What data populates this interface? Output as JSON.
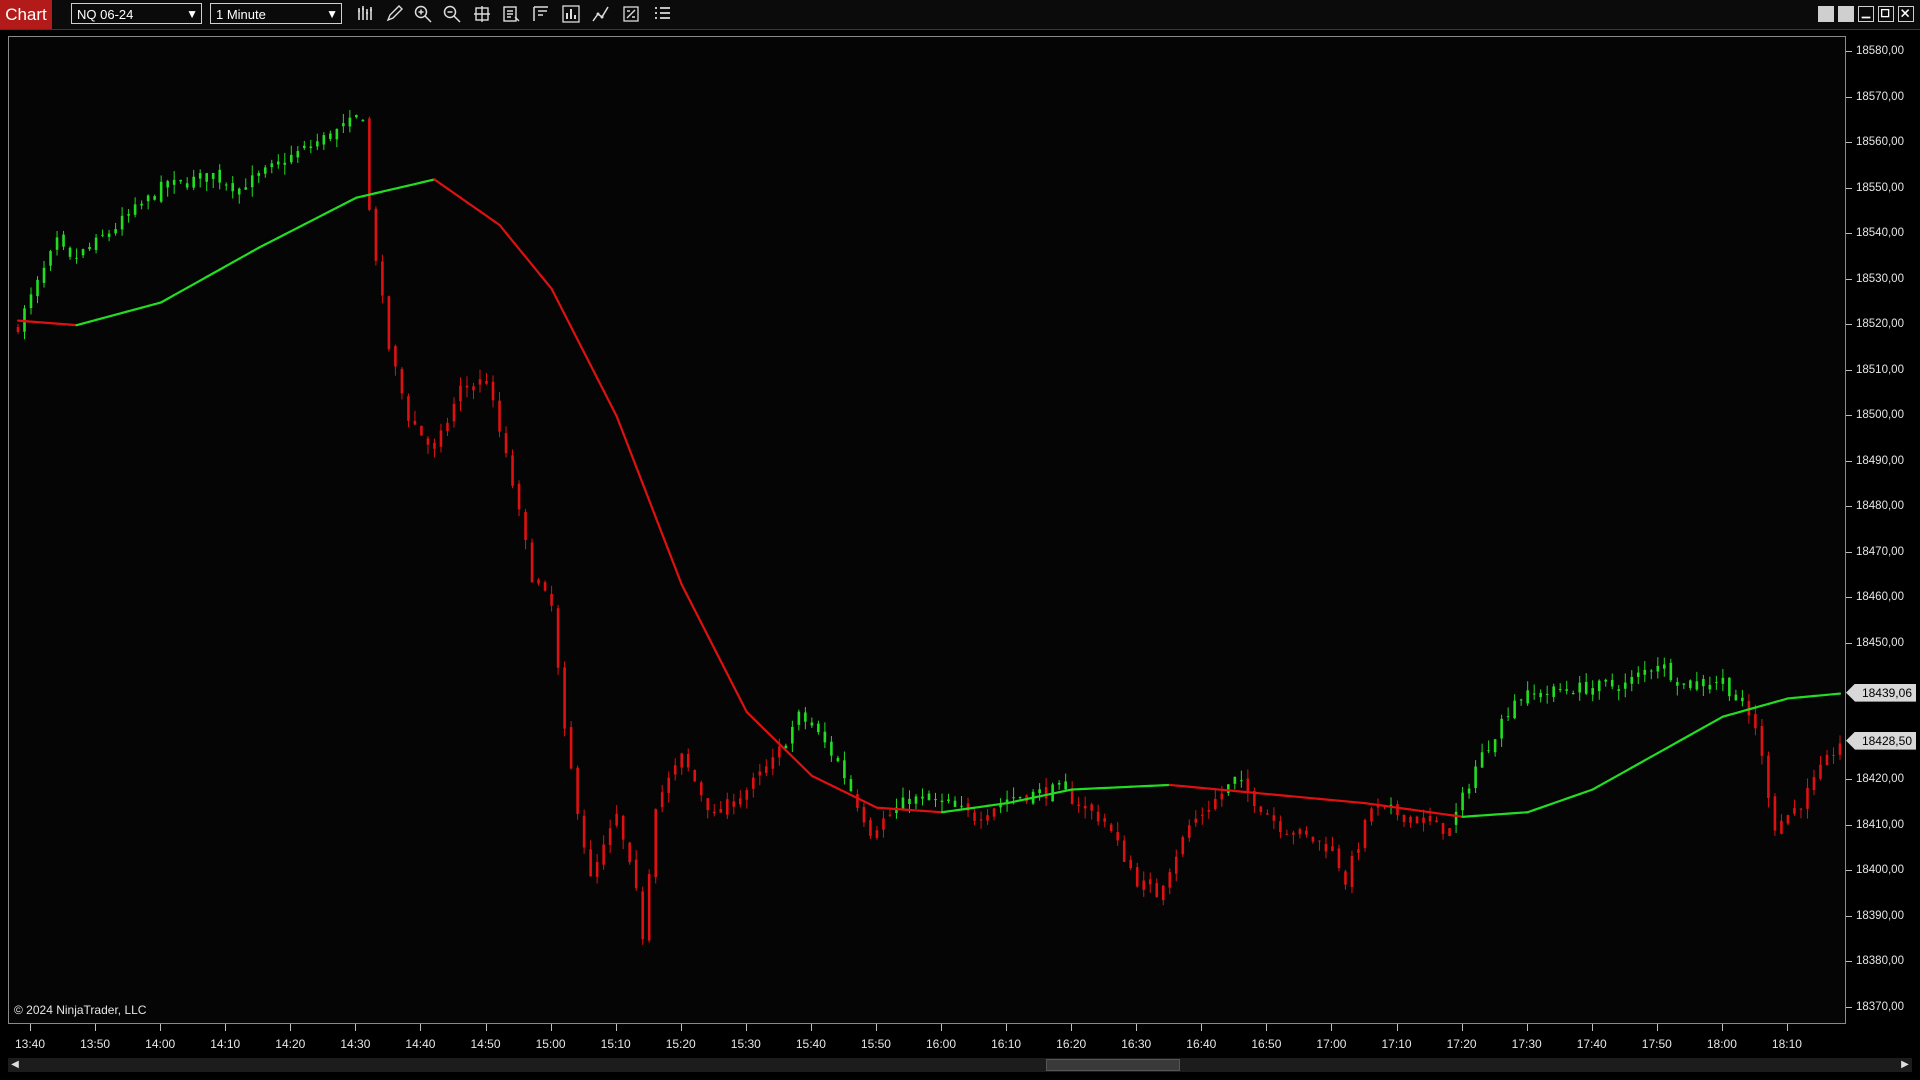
{
  "toolbar": {
    "tab_label": "Chart",
    "instrument": "NQ 06-24",
    "interval": "1 Minute",
    "icons": [
      "bars-type-icon",
      "draw-pencil-icon",
      "zoom-in-icon",
      "zoom-out-icon",
      "crosshair-icon",
      "data-box-icon",
      "range-icon",
      "bar-chart-icon",
      "strategy-icon",
      "properties-icon",
      "indicators-list-icon"
    ],
    "window_icons": [
      "tile-icon",
      "tile-icon",
      "minimize-icon",
      "maximize-icon",
      "close-icon"
    ]
  },
  "colors": {
    "up": "#22dd22",
    "down": "#dd1111",
    "background": "#050505",
    "axis_text": "#e6e6e6"
  },
  "copyright": "© 2024 NinjaTrader, LLC",
  "price_axis": {
    "labels": [
      "18580,00",
      "18570,00",
      "18560,00",
      "18550,00",
      "18540,00",
      "18530,00",
      "18520,00",
      "18510,00",
      "18500,00",
      "18490,00",
      "18480,00",
      "18470,00",
      "18460,00",
      "18450,00",
      "18420,00",
      "18410,00",
      "18400,00",
      "18390,00",
      "18380,00",
      "18370,00"
    ],
    "values": [
      18580,
      18570,
      18560,
      18550,
      18540,
      18530,
      18520,
      18510,
      18500,
      18490,
      18480,
      18470,
      18460,
      18450,
      18420,
      18410,
      18400,
      18390,
      18380,
      18370
    ],
    "ma_value_label": "18439,06",
    "last_price_label": "18428,50"
  },
  "time_axis": {
    "labels": [
      "13:40",
      "13:50",
      "14:00",
      "14:10",
      "14:20",
      "14:30",
      "14:40",
      "14:50",
      "15:00",
      "15:10",
      "15:20",
      "15:30",
      "15:40",
      "15:50",
      "16:00",
      "16:10",
      "16:20",
      "16:30",
      "16:40",
      "16:50",
      "17:00",
      "17:10",
      "17:20",
      "17:30",
      "17:40",
      "17:50",
      "18:00",
      "18:10"
    ]
  },
  "chart_data": {
    "type": "candlestick",
    "instrument": "NQ 06-24",
    "interval": "1 Minute",
    "ylim": [
      18367,
      18582
    ],
    "close_anchors": [
      {
        "t": "13:38",
        "p": 18520
      },
      {
        "t": "13:44",
        "p": 18538
      },
      {
        "t": "13:46",
        "p": 18534
      },
      {
        "t": "13:50",
        "p": 18538
      },
      {
        "t": "14:00",
        "p": 18550
      },
      {
        "t": "14:08",
        "p": 18553
      },
      {
        "t": "14:12",
        "p": 18550
      },
      {
        "t": "14:20",
        "p": 18557
      },
      {
        "t": "14:30",
        "p": 18565
      },
      {
        "t": "14:31",
        "p": 18566
      },
      {
        "t": "14:32",
        "p": 18545
      },
      {
        "t": "14:35",
        "p": 18515
      },
      {
        "t": "14:38",
        "p": 18500
      },
      {
        "t": "14:42",
        "p": 18492
      },
      {
        "t": "14:46",
        "p": 18506
      },
      {
        "t": "14:50",
        "p": 18508
      },
      {
        "t": "14:54",
        "p": 18485
      },
      {
        "t": "14:57",
        "p": 18465
      },
      {
        "t": "15:00",
        "p": 18458
      },
      {
        "t": "15:02",
        "p": 18430
      },
      {
        "t": "15:06",
        "p": 18398
      },
      {
        "t": "15:10",
        "p": 18412
      },
      {
        "t": "15:13",
        "p": 18395
      },
      {
        "t": "15:14",
        "p": 18386
      },
      {
        "t": "15:16",
        "p": 18415
      },
      {
        "t": "15:20",
        "p": 18425
      },
      {
        "t": "15:25",
        "p": 18412
      },
      {
        "t": "15:30",
        "p": 18418
      },
      {
        "t": "15:34",
        "p": 18424
      },
      {
        "t": "15:38",
        "p": 18434
      },
      {
        "t": "15:40",
        "p": 18432
      },
      {
        "t": "15:44",
        "p": 18424
      },
      {
        "t": "15:49",
        "p": 18409
      },
      {
        "t": "15:55",
        "p": 18416
      },
      {
        "t": "16:00",
        "p": 18415
      },
      {
        "t": "16:05",
        "p": 18412
      },
      {
        "t": "16:10",
        "p": 18416
      },
      {
        "t": "16:18",
        "p": 18418
      },
      {
        "t": "16:25",
        "p": 18411
      },
      {
        "t": "16:30",
        "p": 18398
      },
      {
        "t": "16:33",
        "p": 18395
      },
      {
        "t": "16:38",
        "p": 18410
      },
      {
        "t": "16:45",
        "p": 18420
      },
      {
        "t": "16:52",
        "p": 18410
      },
      {
        "t": "17:00",
        "p": 18405
      },
      {
        "t": "17:02",
        "p": 18398
      },
      {
        "t": "17:06",
        "p": 18414
      },
      {
        "t": "17:12",
        "p": 18412
      },
      {
        "t": "17:18",
        "p": 18409
      },
      {
        "t": "17:22",
        "p": 18423
      },
      {
        "t": "17:28",
        "p": 18438
      },
      {
        "t": "17:36",
        "p": 18440
      },
      {
        "t": "17:45",
        "p": 18441
      },
      {
        "t": "17:50",
        "p": 18446
      },
      {
        "t": "17:54",
        "p": 18441
      },
      {
        "t": "18:00",
        "p": 18442
      },
      {
        "t": "18:05",
        "p": 18432
      },
      {
        "t": "18:08",
        "p": 18410
      },
      {
        "t": "18:12",
        "p": 18415
      },
      {
        "t": "18:15",
        "p": 18422
      },
      {
        "t": "18:18",
        "p": 18428.5
      }
    ],
    "moving_average": {
      "name": "",
      "anchors": [
        {
          "t": "13:38",
          "p": 18521
        },
        {
          "t": "13:47",
          "p": 18520
        },
        {
          "t": "14:00",
          "p": 18525
        },
        {
          "t": "14:15",
          "p": 18537
        },
        {
          "t": "14:30",
          "p": 18548
        },
        {
          "t": "14:42",
          "p": 18552
        },
        {
          "t": "14:52",
          "p": 18542
        },
        {
          "t": "15:00",
          "p": 18528
        },
        {
          "t": "15:10",
          "p": 18500
        },
        {
          "t": "15:20",
          "p": 18463
        },
        {
          "t": "15:30",
          "p": 18435
        },
        {
          "t": "15:40",
          "p": 18421
        },
        {
          "t": "15:50",
          "p": 18414
        },
        {
          "t": "16:00",
          "p": 18413
        },
        {
          "t": "16:10",
          "p": 18415
        },
        {
          "t": "16:20",
          "p": 18418
        },
        {
          "t": "16:35",
          "p": 18419
        },
        {
          "t": "16:50",
          "p": 18417
        },
        {
          "t": "17:05",
          "p": 18415
        },
        {
          "t": "17:20",
          "p": 18412
        },
        {
          "t": "17:30",
          "p": 18413
        },
        {
          "t": "17:40",
          "p": 18418
        },
        {
          "t": "17:50",
          "p": 18426
        },
        {
          "t": "18:00",
          "p": 18434
        },
        {
          "t": "18:10",
          "p": 18438
        },
        {
          "t": "18:18",
          "p": 18439.06
        }
      ]
    }
  }
}
